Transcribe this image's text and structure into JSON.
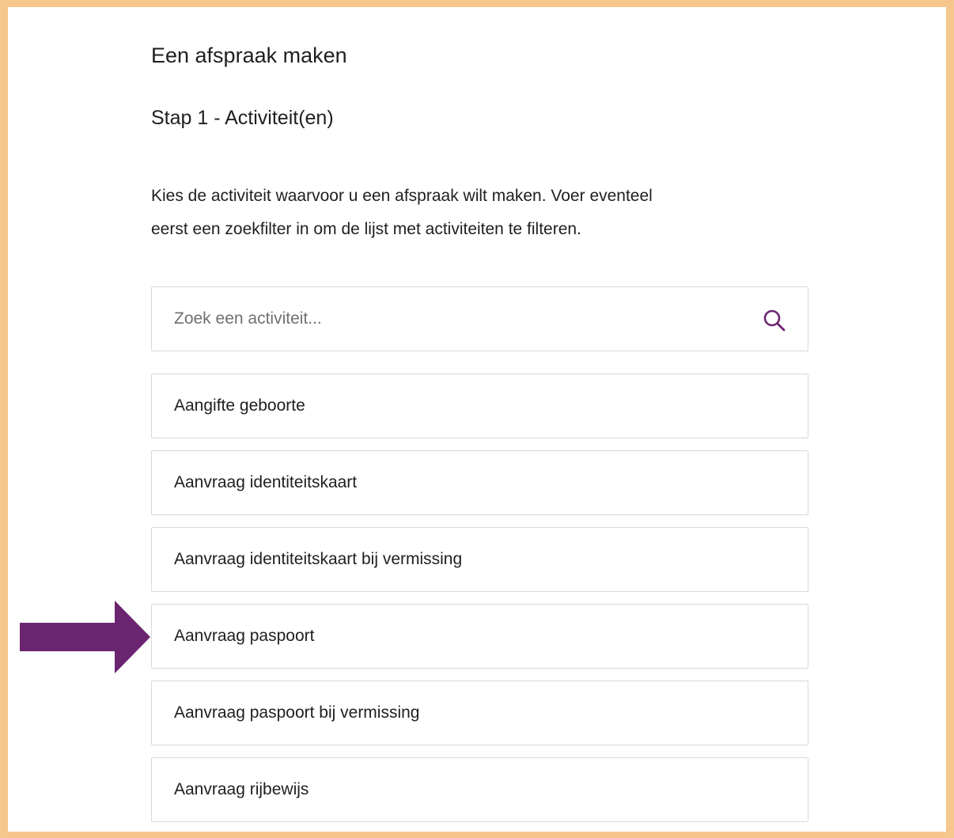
{
  "page": {
    "title": "Een afspraak maken",
    "step_title": "Stap 1 - Activiteit(en)",
    "intro_line_1": "Kies de activiteit waarvoor u een afspraak wilt maken. Voer eventeel",
    "intro_line_2": "eerst een zoekfilter in om de lijst met activiteiten te filteren."
  },
  "search": {
    "placeholder": "Zoek een activiteit...",
    "value": "",
    "icon": "search-icon"
  },
  "activities": [
    {
      "label": "Aangifte geboorte"
    },
    {
      "label": "Aanvraag identiteitskaart"
    },
    {
      "label": "Aanvraag identiteitskaart bij vermissing"
    },
    {
      "label": "Aanvraag paspoort"
    },
    {
      "label": "Aanvraag paspoort bij vermissing"
    },
    {
      "label": "Aanvraag rijbewijs"
    }
  ],
  "colors": {
    "frame_border": "#f6c68c",
    "arrow": "#6b2470",
    "search_icon": "#6b2470",
    "item_border": "#d8d8d8",
    "text": "#1f1f1f"
  },
  "annotation": {
    "icon": "arrow-right-icon",
    "points_to": "Aanvraag paspoort"
  }
}
